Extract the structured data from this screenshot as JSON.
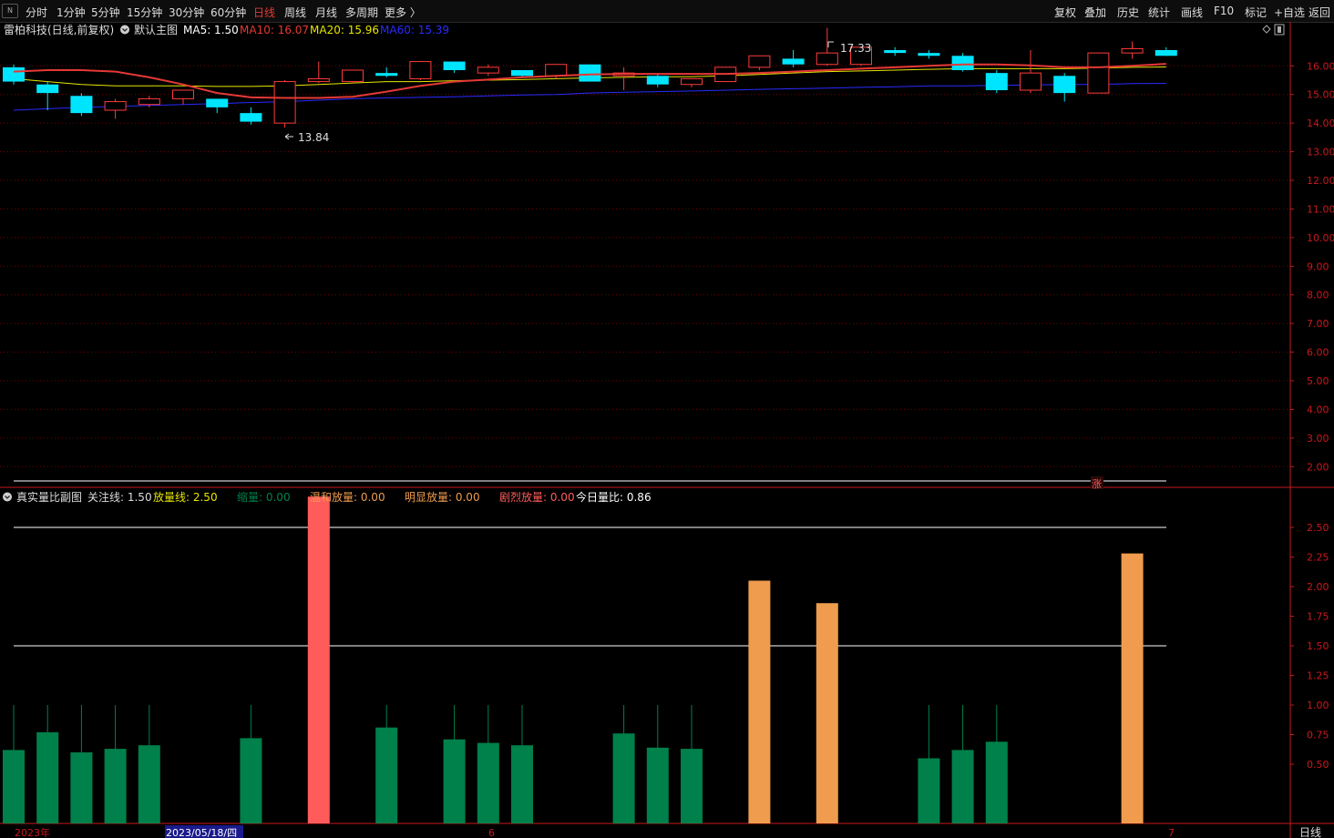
{
  "toolbar": {
    "logo_label": "N",
    "periods": [
      "分时",
      "1分钟",
      "5分钟",
      "15分钟",
      "30分钟",
      "60分钟",
      "日线",
      "周线",
      "月线",
      "多周期",
      "更多 〉"
    ],
    "selected_period": "日线",
    "right_buttons": [
      "复权",
      "叠加",
      "历史",
      "统计",
      "画线",
      "F10",
      "标记",
      "+自选",
      "返回"
    ]
  },
  "main_legend": {
    "stock": "雷柏科技(日线,前复权)",
    "template": "默认主图",
    "ma5": "MA5: 1.50",
    "ma10": "MA10: 16.07",
    "ma20": "MA20: 15.96",
    "ma60": "MA60: 15.39"
  },
  "annotations": {
    "high": "17.33",
    "low": "13.84",
    "badge": "涨"
  },
  "sub_legend": {
    "title": "真实量比副图",
    "focus": "关注线: 1.50",
    "expand_line": "放量线: 2.50",
    "shrink": "缩量: 0.00",
    "mild": "温和放量: 0.00",
    "obvious": "明显放量: 0.00",
    "intense": "剧烈放量: 0.00",
    "today": "今日量比: 0.86"
  },
  "date_axis": {
    "year": "2023年",
    "cursor": "2023/05/18/四",
    "m6": "6",
    "m7": "7",
    "period": "日线"
  },
  "colors": {
    "up": "#ff3b3b",
    "down": "#00e5ff",
    "ma5": "#ffffff",
    "ma10": "#e53935",
    "ma20": "#e6e600",
    "ma60": "#2a2aff",
    "shrink_bar": "#00804a",
    "intense_bar": "#ff5b5b",
    "obvious_bar": "#ef9c4e",
    "grid": "#7a0000",
    "axis": "#c8191e"
  },
  "chart_data": [
    {
      "type": "candlestick",
      "title": "雷柏科技(日线,前复权)",
      "ylim": [
        1.5,
        16.9
      ],
      "price_ticks": [
        "16.00",
        "15.00",
        "14.00",
        "13.00",
        "12.00",
        "11.00",
        "10.00",
        "9.00",
        "8.00",
        "7.00",
        "6.00",
        "5.00",
        "4.00",
        "3.00",
        "2.00"
      ],
      "candles": [
        {
          "o": 15.95,
          "h": 16.05,
          "c": 15.45,
          "l": 15.35
        },
        {
          "o": 15.35,
          "h": 15.45,
          "c": 15.05,
          "l": 14.45
        },
        {
          "o": 14.95,
          "h": 15.05,
          "c": 14.35,
          "l": 14.25
        },
        {
          "o": 14.45,
          "h": 14.85,
          "c": 14.75,
          "l": 14.15
        },
        {
          "o": 14.65,
          "h": 14.95,
          "c": 14.85,
          "l": 14.55
        },
        {
          "o": 14.85,
          "h": 15.15,
          "c": 15.15,
          "l": 14.65
        },
        {
          "o": 14.85,
          "h": 14.85,
          "c": 14.55,
          "l": 14.35
        },
        {
          "o": 14.35,
          "h": 14.55,
          "c": 14.05,
          "l": 13.95
        },
        {
          "o": 14.0,
          "h": 15.5,
          "c": 15.45,
          "l": 13.84
        },
        {
          "o": 15.45,
          "h": 16.15,
          "c": 15.55,
          "l": 15.4
        },
        {
          "o": 15.45,
          "h": 15.85,
          "c": 15.85,
          "l": 15.4
        },
        {
          "o": 15.75,
          "h": 15.95,
          "c": 15.65,
          "l": 15.6
        },
        {
          "o": 15.55,
          "h": 16.15,
          "c": 16.15,
          "l": 15.5
        },
        {
          "o": 16.15,
          "h": 16.15,
          "c": 15.85,
          "l": 15.75
        },
        {
          "o": 15.75,
          "h": 16.05,
          "c": 15.95,
          "l": 15.65
        },
        {
          "o": 15.85,
          "h": 15.85,
          "c": 15.65,
          "l": 15.6
        },
        {
          "o": 15.65,
          "h": 16.05,
          "c": 16.05,
          "l": 15.55
        },
        {
          "o": 16.05,
          "h": 16.05,
          "c": 15.45,
          "l": 15.45
        },
        {
          "o": 15.65,
          "h": 15.95,
          "c": 15.75,
          "l": 15.15
        },
        {
          "o": 15.65,
          "h": 15.75,
          "c": 15.35,
          "l": 15.25
        },
        {
          "o": 15.35,
          "h": 15.55,
          "c": 15.55,
          "l": 15.25
        },
        {
          "o": 15.45,
          "h": 15.95,
          "c": 15.95,
          "l": 15.45
        },
        {
          "o": 15.95,
          "h": 16.35,
          "c": 16.35,
          "l": 15.85
        },
        {
          "o": 16.25,
          "h": 16.55,
          "c": 16.05,
          "l": 15.95
        },
        {
          "o": 16.05,
          "h": 17.33,
          "c": 16.45,
          "l": 16.0
        },
        {
          "o": 16.05,
          "h": 16.65,
          "c": 16.65,
          "l": 16.0
        },
        {
          "o": 16.55,
          "h": 16.65,
          "c": 16.45,
          "l": 16.35
        },
        {
          "o": 16.45,
          "h": 16.55,
          "c": 16.35,
          "l": 16.25
        },
        {
          "o": 16.35,
          "h": 16.45,
          "c": 15.85,
          "l": 15.8
        },
        {
          "o": 15.75,
          "h": 15.85,
          "c": 15.15,
          "l": 15.05
        },
        {
          "o": 15.15,
          "h": 16.55,
          "c": 15.75,
          "l": 15.05
        },
        {
          "o": 15.65,
          "h": 15.75,
          "c": 15.05,
          "l": 14.75
        },
        {
          "o": 15.05,
          "h": 16.45,
          "c": 16.45,
          "l": 15.05
        },
        {
          "o": 16.45,
          "h": 16.85,
          "c": 16.6,
          "l": 16.25
        },
        {
          "o": 16.55,
          "h": 16.65,
          "c": 16.35,
          "l": 16.35
        }
      ],
      "ma10": [
        15.8,
        15.85,
        15.85,
        15.8,
        15.6,
        15.35,
        15.05,
        14.9,
        14.88,
        14.88,
        14.92,
        15.1,
        15.3,
        15.45,
        15.52,
        15.6,
        15.65,
        15.7,
        15.72,
        15.72,
        15.72,
        15.72,
        15.75,
        15.8,
        15.85,
        15.9,
        15.95,
        16.0,
        16.05,
        16.05,
        16.02,
        15.95,
        15.95,
        16.0,
        16.07
      ],
      "ma20": [
        15.55,
        15.45,
        15.35,
        15.3,
        15.3,
        15.3,
        15.28,
        15.28,
        15.3,
        15.35,
        15.4,
        15.45,
        15.45,
        15.48,
        15.5,
        15.52,
        15.55,
        15.58,
        15.6,
        15.62,
        15.62,
        15.65,
        15.7,
        15.75,
        15.8,
        15.82,
        15.85,
        15.88,
        15.9,
        15.9,
        15.9,
        15.9,
        15.92,
        15.95,
        15.96
      ],
      "ma60": [
        14.45,
        14.5,
        14.55,
        14.58,
        14.62,
        14.65,
        14.68,
        14.72,
        14.75,
        14.8,
        14.85,
        14.88,
        14.9,
        14.92,
        14.95,
        14.98,
        15.0,
        15.05,
        15.08,
        15.1,
        15.12,
        15.15,
        15.18,
        15.2,
        15.22,
        15.25,
        15.27,
        15.3,
        15.3,
        15.32,
        15.33,
        15.35,
        15.35,
        15.38,
        15.39
      ],
      "ref_line": 1.5
    },
    {
      "type": "bar",
      "title": "真实量比副图",
      "ylim": [
        0,
        2.8
      ],
      "ticks": [
        "2.50",
        "2.25",
        "2.00",
        "1.75",
        "1.50",
        "1.25",
        "1.00",
        "0.75",
        "0.50"
      ],
      "h_lines": [
        2.5,
        1.5
      ],
      "bars": [
        {
          "v": 0.62,
          "s": 1.0,
          "k": "shrink"
        },
        {
          "v": 0.77,
          "s": 1.0,
          "k": "shrink"
        },
        {
          "v": 0.6,
          "s": 1.0,
          "k": "shrink"
        },
        {
          "v": 0.63,
          "s": 1.0,
          "k": "shrink"
        },
        {
          "v": 0.66,
          "s": 1.0,
          "k": "shrink"
        },
        {
          "v": null
        },
        {
          "v": null
        },
        {
          "v": 0.72,
          "s": 1.0,
          "k": "shrink"
        },
        {
          "v": null
        },
        {
          "v": 2.76,
          "k": "intense"
        },
        {
          "v": null
        },
        {
          "v": 0.81,
          "s": 1.0,
          "k": "shrink"
        },
        {
          "v": null
        },
        {
          "v": 0.71,
          "s": 1.0,
          "k": "shrink"
        },
        {
          "v": 0.68,
          "s": 1.0,
          "k": "shrink"
        },
        {
          "v": 0.66,
          "s": 1.0,
          "k": "shrink"
        },
        {
          "v": null
        },
        {
          "v": null
        },
        {
          "v": 0.76,
          "s": 1.0,
          "k": "shrink"
        },
        {
          "v": 0.64,
          "s": 1.0,
          "k": "shrink"
        },
        {
          "v": 0.63,
          "s": 1.0,
          "k": "shrink"
        },
        {
          "v": null
        },
        {
          "v": 2.05,
          "k": "obvious"
        },
        {
          "v": null
        },
        {
          "v": 1.86,
          "k": "obvious"
        },
        {
          "v": null
        },
        {
          "v": null
        },
        {
          "v": 0.55,
          "s": 1.0,
          "k": "shrink"
        },
        {
          "v": 0.62,
          "s": 1.0,
          "k": "shrink"
        },
        {
          "v": 0.69,
          "s": 1.0,
          "k": "shrink"
        },
        {
          "v": null
        },
        {
          "v": null
        },
        {
          "v": null
        },
        {
          "v": 2.28,
          "k": "obvious"
        },
        {
          "v": null
        }
      ]
    }
  ]
}
